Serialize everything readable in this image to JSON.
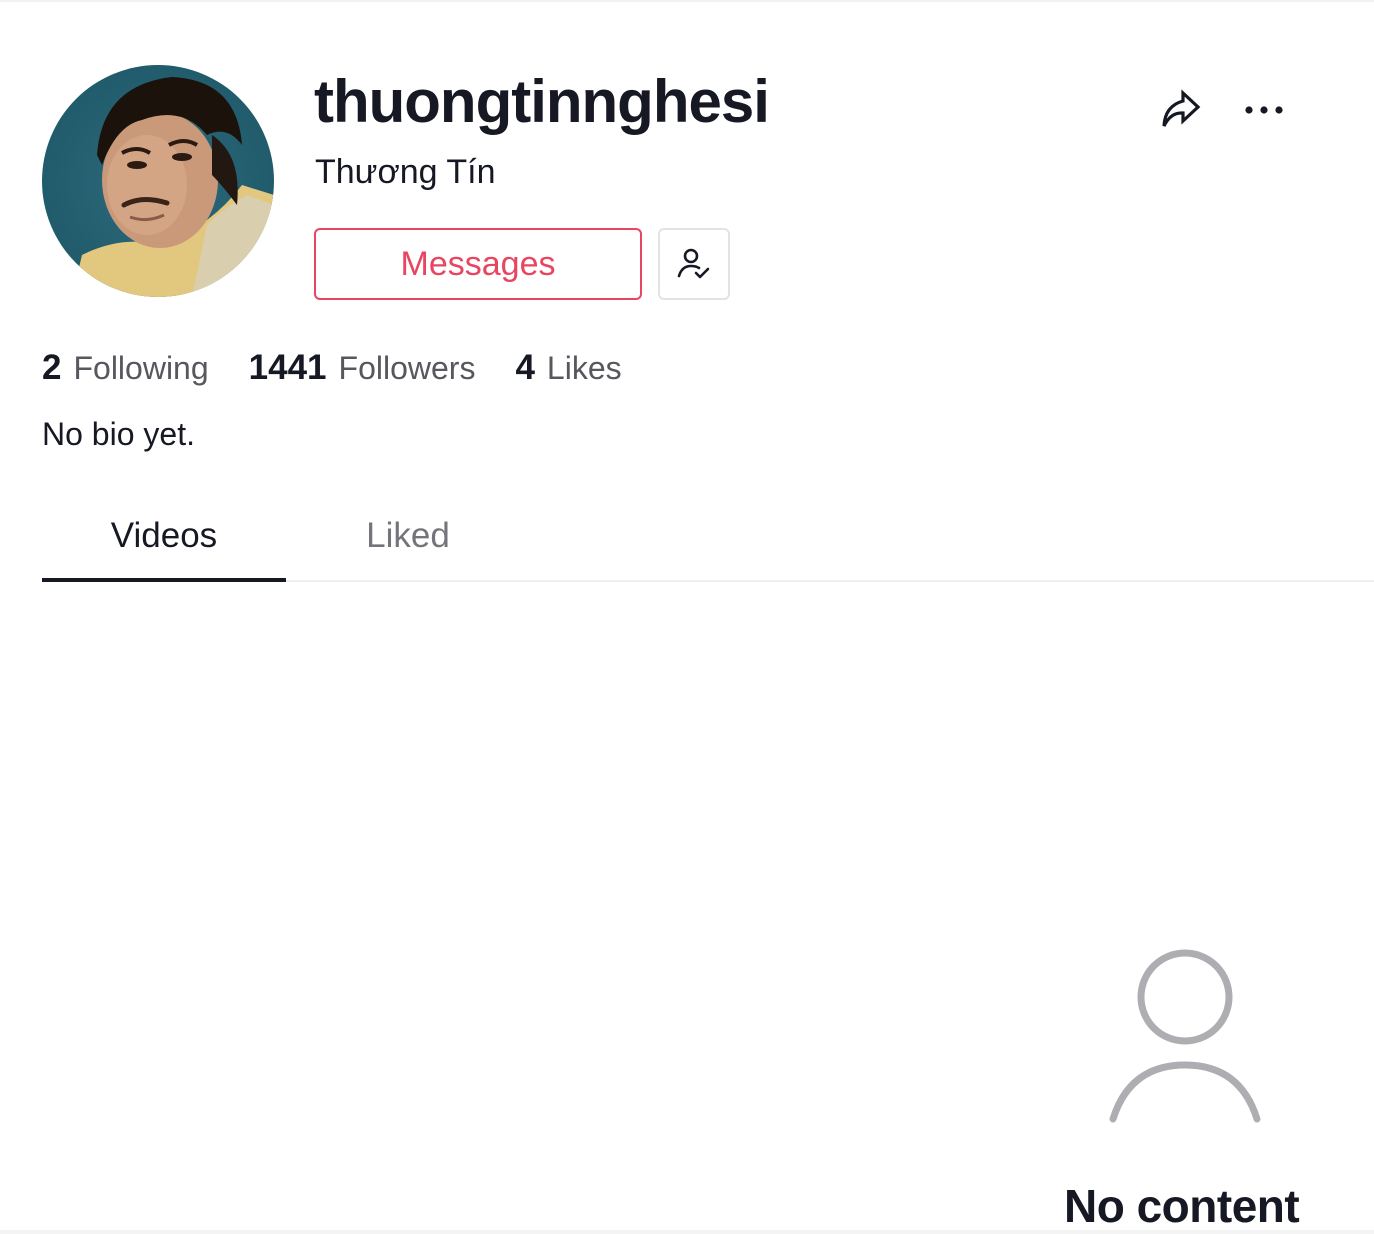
{
  "profile": {
    "username": "thuongtinnghesi",
    "nickname": "Thương Tín",
    "bio": "No bio yet.",
    "avatar_description": "profile photo of a man against a teal background"
  },
  "actions": {
    "messages_label": "Messages",
    "unfollow_icon": "person-check-icon",
    "share_icon": "share-arrow-icon",
    "more_icon": "more-horizontal-icon"
  },
  "stats": [
    {
      "value": "2",
      "label": "Following"
    },
    {
      "value": "1441",
      "label": "Followers"
    },
    {
      "value": "4",
      "label": "Likes"
    }
  ],
  "tabs": [
    {
      "label": "Videos",
      "active": true
    },
    {
      "label": "Liked",
      "active": false
    }
  ],
  "empty_state": {
    "icon": "person-outline-icon",
    "title": "No content"
  },
  "colors": {
    "accent": "#e84560",
    "text_primary": "#161823",
    "text_secondary": "#57575e",
    "empty_icon": "#aeaeb2"
  }
}
